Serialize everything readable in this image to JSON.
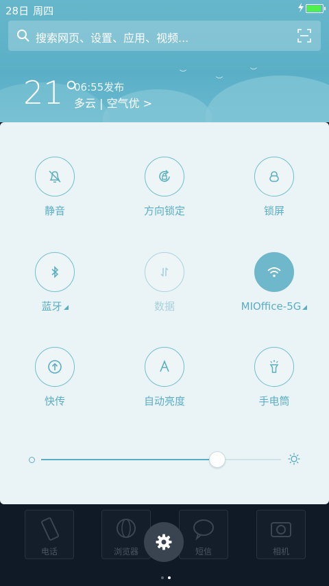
{
  "status": {
    "date": "28日",
    "weekday": "周四",
    "battery_level": 0.9,
    "battery_color": "#4ef24a"
  },
  "search": {
    "placeholder": "搜索网页、设置、应用、视频..."
  },
  "weather": {
    "temperature": "21°",
    "published": "06:55发布",
    "summary": "多云 | 空气优 >"
  },
  "toggles": [
    {
      "label": "静音",
      "icon": "bell-off-icon",
      "state": "off"
    },
    {
      "label": "方向锁定",
      "icon": "rotation-lock-icon",
      "state": "off"
    },
    {
      "label": "锁屏",
      "icon": "lock-icon",
      "state": "off"
    },
    {
      "label": "蓝牙",
      "icon": "bluetooth-icon",
      "state": "off",
      "has_submenu": true
    },
    {
      "label": "数据",
      "icon": "mobile-data-icon",
      "state": "disabled"
    },
    {
      "label": "MIOffice-5G",
      "icon": "wifi-icon",
      "state": "on",
      "has_submenu": true
    },
    {
      "label": "快传",
      "icon": "fast-transfer-icon",
      "state": "off"
    },
    {
      "label": "自动亮度",
      "icon": "auto-brightness-icon",
      "state": "off"
    },
    {
      "label": "手电筒",
      "icon": "flashlight-icon",
      "state": "off"
    }
  ],
  "brightness": {
    "level": 0.73
  },
  "dock": [
    {
      "label": "电话",
      "icon": "phone-icon"
    },
    {
      "label": "浏览器",
      "icon": "browser-icon"
    },
    {
      "label": "短信",
      "icon": "sms-icon"
    },
    {
      "label": "相机",
      "icon": "camera-icon"
    }
  ],
  "pager": {
    "pages": 2,
    "current": 2
  },
  "colors": {
    "accent": "#5aaec4",
    "header": "#5fb3c8",
    "panel": "#eaf3f5"
  }
}
